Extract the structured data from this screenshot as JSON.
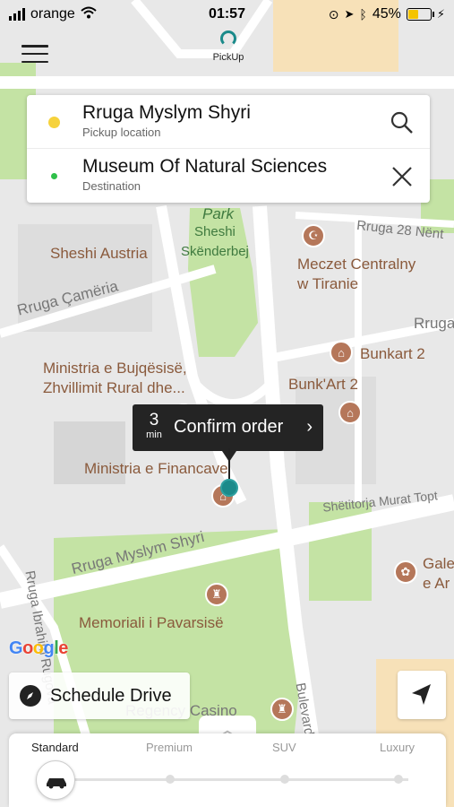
{
  "status": {
    "carrier": "orange",
    "time": "01:57",
    "battery": "45%",
    "battery_fraction": 0.45
  },
  "header": {
    "logo_label": "PickUp"
  },
  "route": {
    "pickup": {
      "name": "Rruga Myslym Shyri",
      "sub": "Pickup location",
      "action_icon": "search-icon"
    },
    "destination": {
      "name": "Museum Of Natural Sciences",
      "sub": "Destination",
      "action_icon": "close-icon"
    }
  },
  "map": {
    "labels": {
      "park": "Park",
      "sheshi_skenderbej": "Sheshi\nSkënderbej",
      "rruga28": "Rruga 28 Nënt",
      "sheshi_austria": "Sheshi Austria",
      "meczet": "Meczet Centralny\nw Tiranie",
      "rruga_cameria": "Rruga Çamëria",
      "rruga_right": "Rruga",
      "bunkart2": "Bunkart 2",
      "ministria_bujq": "Ministria e Bujqësisë,\nZhvillimit Rural dhe...",
      "bunkart_art2": "Bunk'Art 2",
      "ministria_fin": "Ministria e Financave",
      "sheshitorja": "Shëtitorja Murat Topt",
      "rruga_myslym": "Rruga Myslym Shyri",
      "gale": "Gale\ne Ar",
      "rruga_ibrahim": "Rruga Ibrahim Rugova",
      "memoriali": "Memoriali i Pavarsisë",
      "regency": "Regency Casino",
      "bulevard": "Bulevard"
    },
    "attribution": "Google"
  },
  "order": {
    "minutes": "3",
    "minutes_unit": "min",
    "label": "Confirm order",
    "chevron": "›"
  },
  "schedule": {
    "label": "Schedule Drive"
  },
  "tiers": {
    "items": [
      "Standard",
      "Premium",
      "SUV",
      "Luxury"
    ],
    "selected": "Standard"
  },
  "colors": {
    "pickup_dot": "#f6d23c",
    "destination_dot": "#2fc04a",
    "accent": "#1c8a8a",
    "order_bg": "#242424"
  }
}
